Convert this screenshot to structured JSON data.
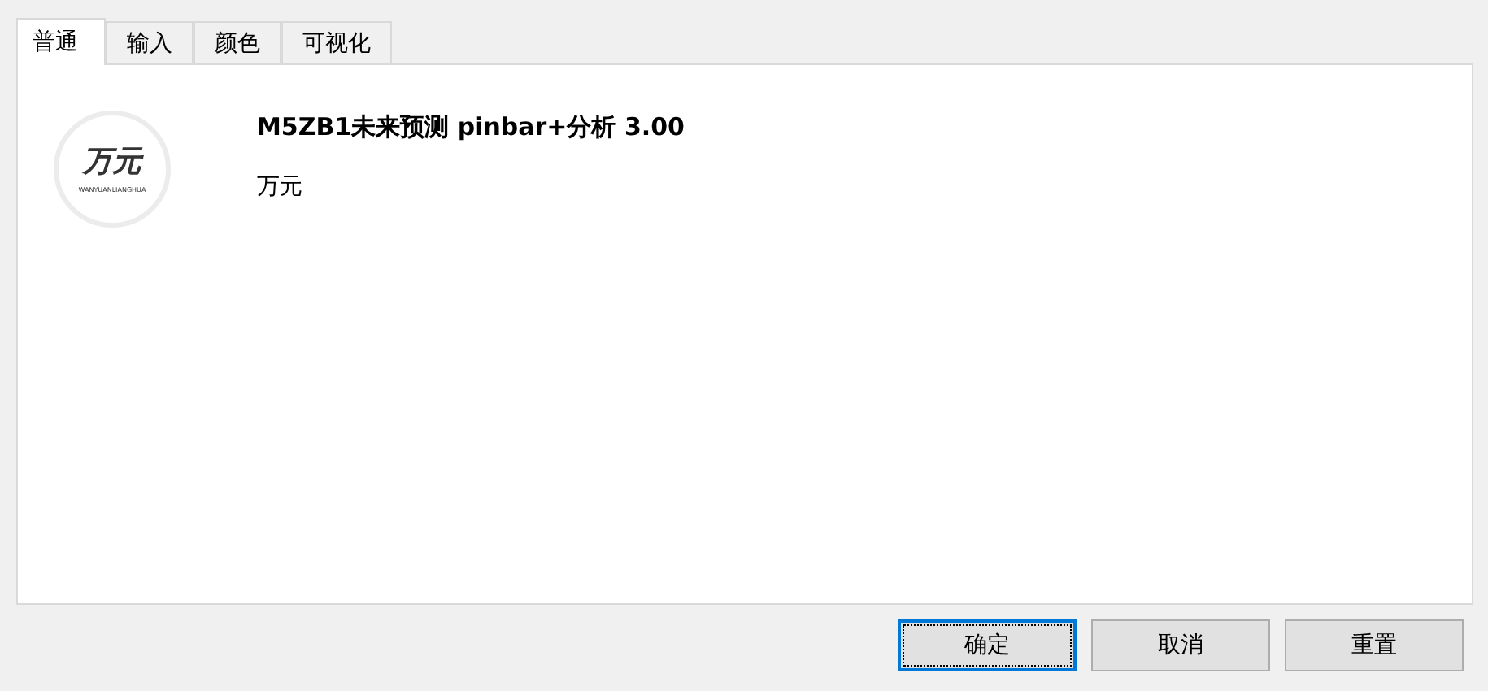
{
  "tabs": [
    {
      "label": "普通",
      "selected": true
    },
    {
      "label": "输入",
      "selected": false
    },
    {
      "label": "颜色",
      "selected": false
    },
    {
      "label": "可视化",
      "selected": false
    }
  ],
  "logo": {
    "title": "万元",
    "subtitle": "WANYUANLIANGHUA"
  },
  "indicator": {
    "name": "M5ZB1未来预测 pinbar+分析 3.00",
    "author": "万元"
  },
  "buttons": [
    {
      "label": "确定",
      "selected": true
    },
    {
      "label": "取消",
      "selected": false
    },
    {
      "label": "重置",
      "selected": false
    }
  ]
}
